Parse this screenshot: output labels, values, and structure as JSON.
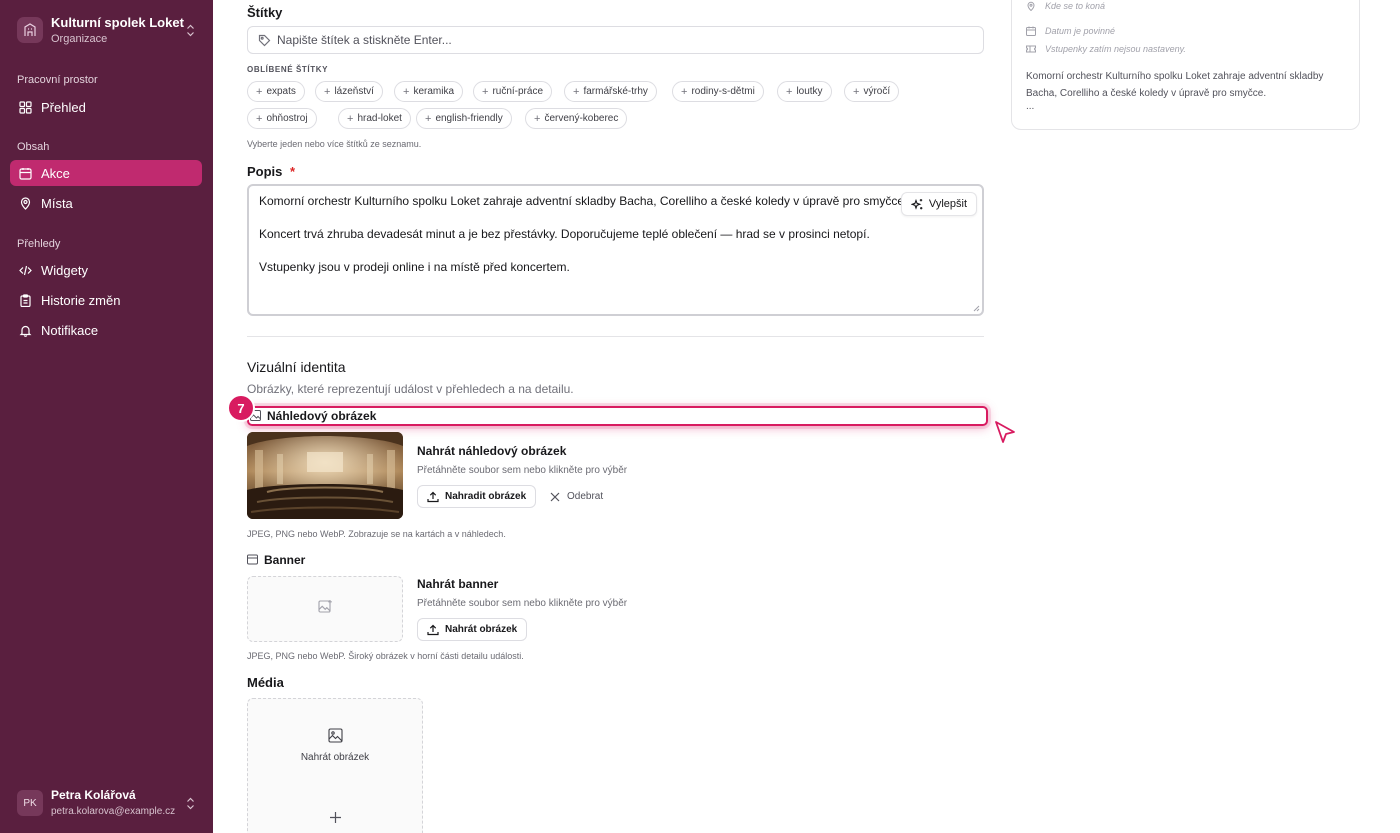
{
  "sidebar": {
    "org_name": "Kulturní spolek Loket",
    "org_type": "Organizace",
    "sections": {
      "workspace": "Pracovní prostor",
      "content": "Obsah",
      "reports": "Přehledy"
    },
    "items": [
      {
        "label": "Přehled",
        "icon": "grid-icon"
      },
      {
        "label": "Akce",
        "icon": "calendar-icon",
        "active": true
      },
      {
        "label": "Místa",
        "icon": "map-pin-icon"
      },
      {
        "label": "Widgety",
        "icon": "code-icon"
      },
      {
        "label": "Historie změn",
        "icon": "clipboard-icon"
      },
      {
        "label": "Notifikace",
        "icon": "bell-icon"
      }
    ],
    "user": {
      "initials": "PK",
      "name": "Petra Kolářová",
      "email": "petra.kolarova@example.cz"
    }
  },
  "tags": {
    "label": "Štítky",
    "placeholder": "Napište štítek a stiskněte Enter...",
    "popular_label": "OBLÍBENÉ ŠTÍTKY",
    "chips": [
      "expats",
      "lázeňství",
      "keramika",
      "ruční-práce",
      "farmářské-trhy",
      "rodiny-s-dětmi",
      "loutky",
      "výročí",
      "ohňostroj",
      "hrad-loket",
      "english-friendly",
      "červený-koberec"
    ],
    "hint": "Vyberte jeden nebo více štítků ze seznamu."
  },
  "description": {
    "label": "Popis",
    "required_mark": "*",
    "lines": [
      "Komorní orchestr Kulturního spolku Loket zahraje adventní skladby Bacha, Corelliho a české koledy v úpravě pro smyčce.",
      "",
      "Koncert trvá zhruba devadesát minut a je bez přestávky. Doporučujeme teplé oblečení — hrad se v prosinci netopí.",
      "",
      "Vstupenky jsou v prodeji online i na místě před koncertem."
    ],
    "improve_button": "Vylepšit"
  },
  "visual": {
    "title": "Vizuální identita",
    "subtitle": "Obrázky, které reprezentují událost v přehledech a na detailu.",
    "step_badge": "7",
    "thumbnail": {
      "label": "Náhledový obrázek",
      "upload_title": "Nahrát náhledový obrázek",
      "upload_hint": "Přetáhněte soubor sem nebo klikněte pro výběr",
      "replace_button": "Nahradit obrázek",
      "remove_button": "Odebrat",
      "note": "JPEG, PNG nebo WebP. Zobrazuje se na kartách a v náhledech."
    },
    "banner": {
      "label": "Banner",
      "upload_title": "Nahrát banner",
      "upload_hint": "Přetáhněte soubor sem nebo klikněte pro výběr",
      "upload_button": "Nahrát obrázek",
      "note": "JPEG, PNG nebo WebP. Široký obrázek v horní části detailu události."
    },
    "media": {
      "label": "Média",
      "upload_label": "Nahrát obrázek"
    }
  },
  "preview_card": {
    "location": "Kde se to koná",
    "date": "Datum je povinné",
    "tickets": "Vstupenky zatím nejsou nastaveny.",
    "description": "Komorní orchestr Kulturního spolku Loket zahraje adventní skladby Bacha, Corelliho a české koledy v úpravě pro smyčce.",
    "ellipsis": "..."
  },
  "colors": {
    "sidebar_bg": "#5a1f3f",
    "accent": "#c02a6f",
    "highlight": "#d81b60"
  }
}
